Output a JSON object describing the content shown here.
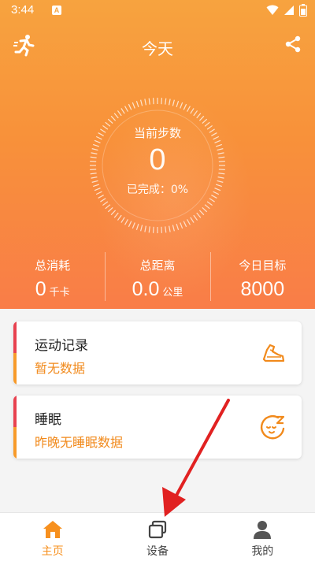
{
  "status": {
    "time": "3:44",
    "notif_badge": "A"
  },
  "header": {
    "title": "今天"
  },
  "steps": {
    "label": "当前步数",
    "value": "0",
    "completion": "已完成：0%"
  },
  "stats": [
    {
      "label": "总消耗",
      "value": "0",
      "unit": "千卡"
    },
    {
      "label": "总距离",
      "value": "0.0",
      "unit": "公里"
    },
    {
      "label": "今日目标",
      "value": "8000",
      "unit": ""
    }
  ],
  "cards": {
    "exercise": {
      "title": "运动记录",
      "subtitle": "暂无数据"
    },
    "sleep": {
      "title": "睡眠",
      "subtitle": "昨晚无睡眠数据"
    }
  },
  "nav": [
    {
      "label": "主页",
      "icon": "home-icon",
      "active": true
    },
    {
      "label": "设备",
      "icon": "device-icon",
      "active": false
    },
    {
      "label": "我的",
      "icon": "profile-icon",
      "active": false
    }
  ],
  "colors": {
    "accent": "#f7901e",
    "hero_top": "#f7a33f",
    "hero_bottom": "#f97d48",
    "card_red": "#e8414f",
    "card_orange": "#f79a2a",
    "arrow": "#e12121"
  }
}
